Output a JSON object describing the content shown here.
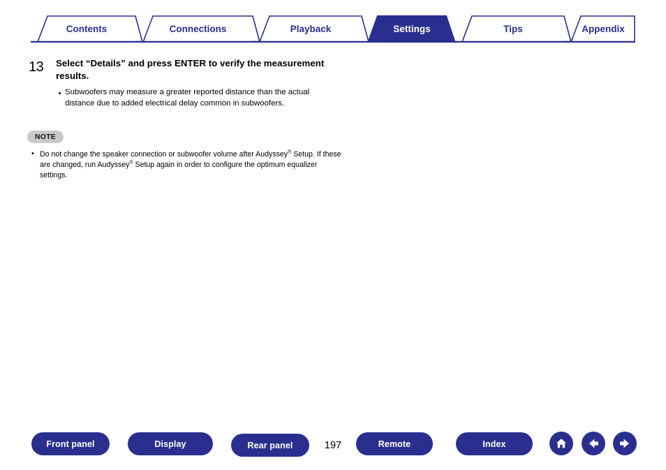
{
  "tabs": [
    {
      "label": "Contents",
      "active": false
    },
    {
      "label": "Connections",
      "active": false
    },
    {
      "label": "Playback",
      "active": false
    },
    {
      "label": "Settings",
      "active": true
    },
    {
      "label": "Tips",
      "active": false
    },
    {
      "label": "Appendix",
      "active": false
    }
  ],
  "step": {
    "number": "13",
    "title": "Select “Details” and press ENTER to verify the measurement results.",
    "bullets": [
      "Subwoofers may measure a greater reported distance than the actual distance due to added electrical delay common in subwoofers."
    ]
  },
  "note": {
    "badge": "NOTE",
    "text_part1": "Do not change the speaker connection or subwoofer volume after Audyssey",
    "sup1": "®",
    "text_part2": " Setup. If these are changed, run Audyssey",
    "sup2": "®",
    "text_part3": " Setup again in order to configure the optimum equalizer settings."
  },
  "footer": {
    "buttons": [
      {
        "label": "Front panel"
      },
      {
        "label": "Display"
      },
      {
        "label": "Rear panel"
      },
      {
        "label": "Remote"
      },
      {
        "label": "Index"
      }
    ],
    "page": "197",
    "nav": [
      {
        "icon": "home-icon"
      },
      {
        "icon": "arrow-left-icon"
      },
      {
        "icon": "arrow-right-icon"
      }
    ]
  },
  "colors": {
    "brand": "#2a2f8f",
    "note_badge": "#c8c9cb"
  }
}
